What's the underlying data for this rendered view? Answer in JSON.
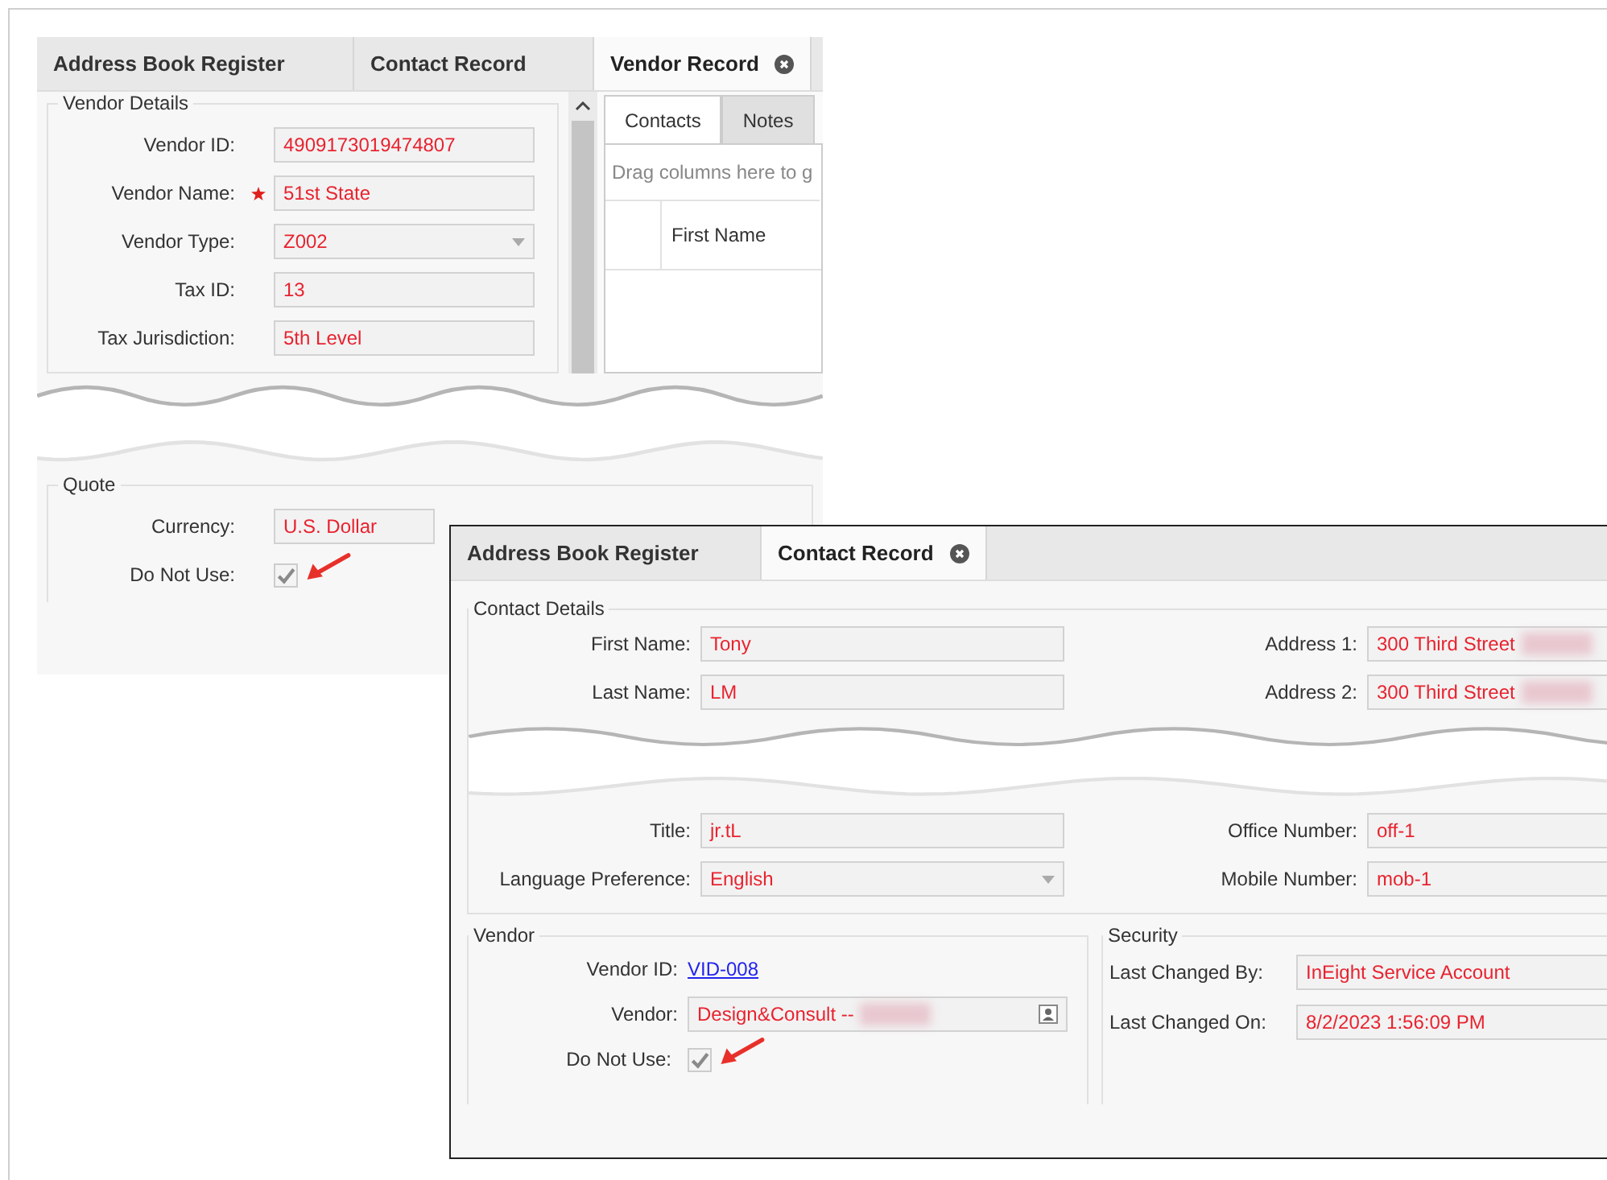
{
  "vendor_window": {
    "tabs": [
      {
        "label": "Address Book Register",
        "selected": false
      },
      {
        "label": "Contact Record",
        "selected": false
      },
      {
        "label": "Vendor Record",
        "selected": true
      }
    ],
    "details": {
      "title": "Vendor Details",
      "fields": [
        {
          "label": "Vendor ID:",
          "value": "4909173019474807",
          "kind": "text",
          "required": false
        },
        {
          "label": "Vendor Name:",
          "value": "51st State",
          "kind": "text",
          "required": true
        },
        {
          "label": "Vendor Type:",
          "value": "Z002",
          "kind": "dropdown",
          "required": false
        },
        {
          "label": "Tax ID:",
          "value": "13",
          "kind": "text",
          "required": false
        },
        {
          "label": "Tax Jurisdiction:",
          "value": "5th Level",
          "kind": "text",
          "required": false
        }
      ]
    },
    "subtabs": [
      {
        "label": "Contacts",
        "selected": true
      },
      {
        "label": "Notes",
        "selected": false
      }
    ],
    "grid": {
      "group_hint": "Drag columns here to g",
      "columns": [
        "First Name"
      ]
    },
    "quote": {
      "title": "Quote",
      "currency": {
        "label": "Currency:",
        "value": "U.S. Dollar"
      },
      "do_not_use": {
        "label": "Do Not Use:",
        "checked": true
      }
    }
  },
  "contact_window": {
    "tabs": [
      {
        "label": "Address Book Register",
        "selected": false
      },
      {
        "label": "Contact Record",
        "selected": true
      }
    ],
    "details": {
      "title": "Contact Details",
      "upper_rows": [
        [
          {
            "label": "First Name:",
            "value": "Tony",
            "kind": "text"
          },
          {
            "label": "Address 1:",
            "value": "300 Third Street",
            "kind": "text",
            "redacted": true
          }
        ],
        [
          {
            "label": "Last Name:",
            "value": "LM",
            "kind": "text"
          },
          {
            "label": "Address 2:",
            "value": "300 Third Street",
            "kind": "text",
            "redacted": true
          }
        ]
      ],
      "lower_rows": [
        [
          {
            "label": "Title:",
            "value": "jr.tL",
            "kind": "text"
          },
          {
            "label": "Office Number:",
            "value": "off-1",
            "kind": "text"
          }
        ],
        [
          {
            "label": "Language Preference:",
            "value": "English",
            "kind": "dropdown"
          },
          {
            "label": "Mobile Number:",
            "value": "mob-1",
            "kind": "text"
          }
        ]
      ]
    },
    "vendor": {
      "title": "Vendor",
      "fields": [
        {
          "label": "Vendor ID:",
          "value": "VID-008",
          "kind": "link"
        },
        {
          "label": "Vendor:",
          "value": "Design&Consult --",
          "kind": "lookup",
          "redacted": true
        }
      ],
      "do_not_use": {
        "label": "Do Not Use:",
        "checked": true
      }
    },
    "security": {
      "title": "Security",
      "fields": [
        {
          "label": "Last Changed By:",
          "value": "InEight Service Account",
          "kind": "text"
        },
        {
          "label": "Last Changed On:",
          "value": "8/2/2023 1:56:09 PM",
          "kind": "text"
        }
      ]
    }
  }
}
